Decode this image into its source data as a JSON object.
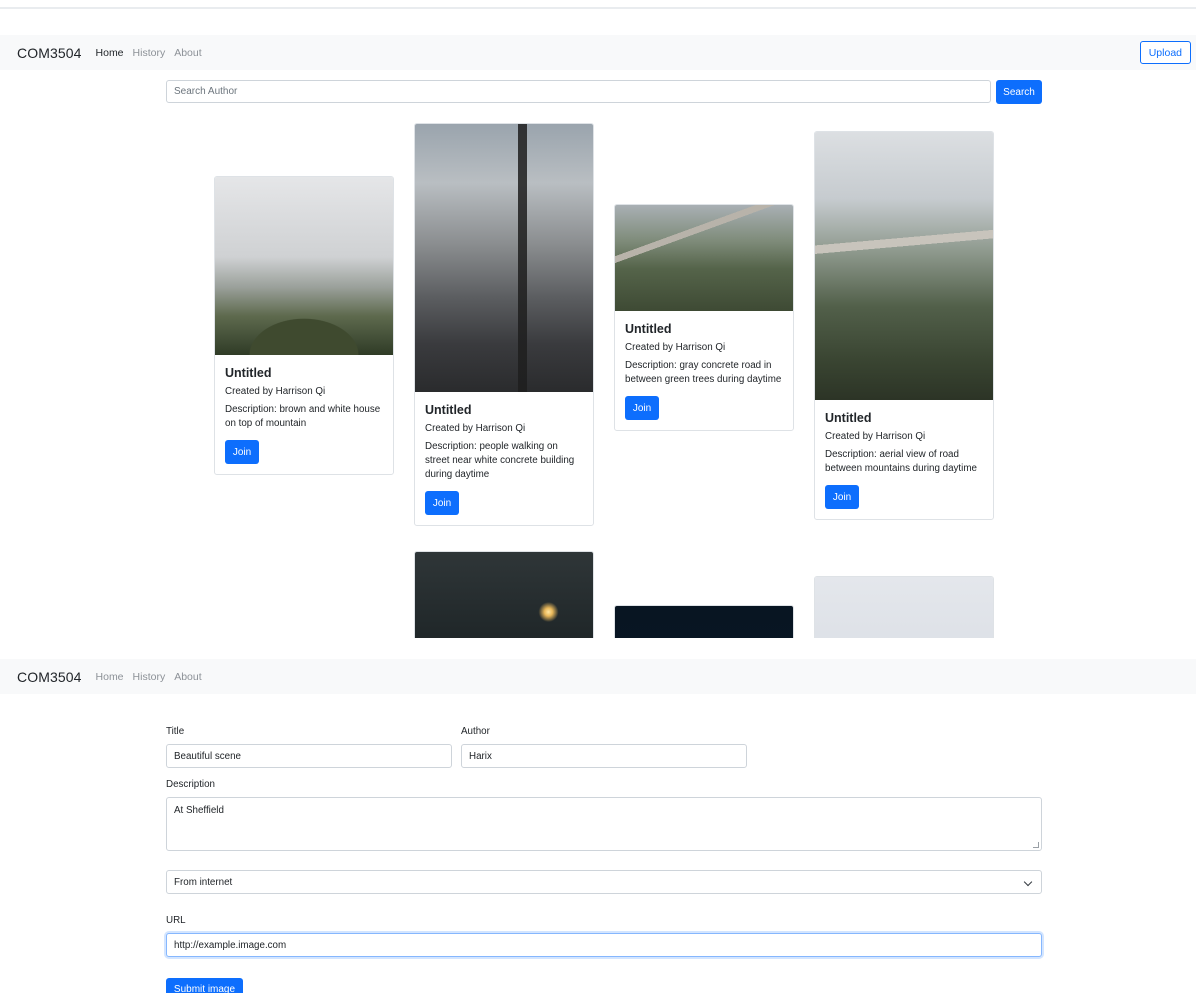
{
  "screen1": {
    "navbar": {
      "brand": "COM3504",
      "links": [
        "Home",
        "History",
        "About"
      ],
      "upload_label": "Upload"
    },
    "search": {
      "placeholder": "Search Author",
      "button_label": "Search"
    },
    "cards": [
      {
        "title": "Untitled",
        "creator": "Created by Harrison Qi",
        "description": "Description: brown and white house on top of mountain",
        "join_label": "Join"
      },
      {
        "title": "Untitled",
        "creator": "Created by Harrison Qi",
        "description": "Description: people walking on street near white concrete building during daytime",
        "join_label": "Join"
      },
      {
        "title": "Untitled",
        "creator": "Created by Harrison Qi",
        "description": "Description: gray concrete road in between green trees during daytime",
        "join_label": "Join"
      },
      {
        "title": "Untitled",
        "creator": "Created by Harrison Qi",
        "description": "Description: aerial view of road between mountains during daytime",
        "join_label": "Join"
      }
    ]
  },
  "screen2": {
    "navbar": {
      "brand": "COM3504",
      "links": [
        "Home",
        "History",
        "About"
      ]
    },
    "form": {
      "title_label": "Title",
      "title_value": "Beautiful scene",
      "author_label": "Author",
      "author_value": "Harix",
      "description_label": "Description",
      "description_value": "At Sheffield",
      "source_selected": "From internet",
      "url_label": "URL",
      "url_value": "http://example.image.com",
      "submit_label": "Submit image"
    }
  },
  "colors": {
    "primary": "#0d6efd",
    "navbar_bg": "#f8f9fa",
    "border": "#dee2e6"
  }
}
